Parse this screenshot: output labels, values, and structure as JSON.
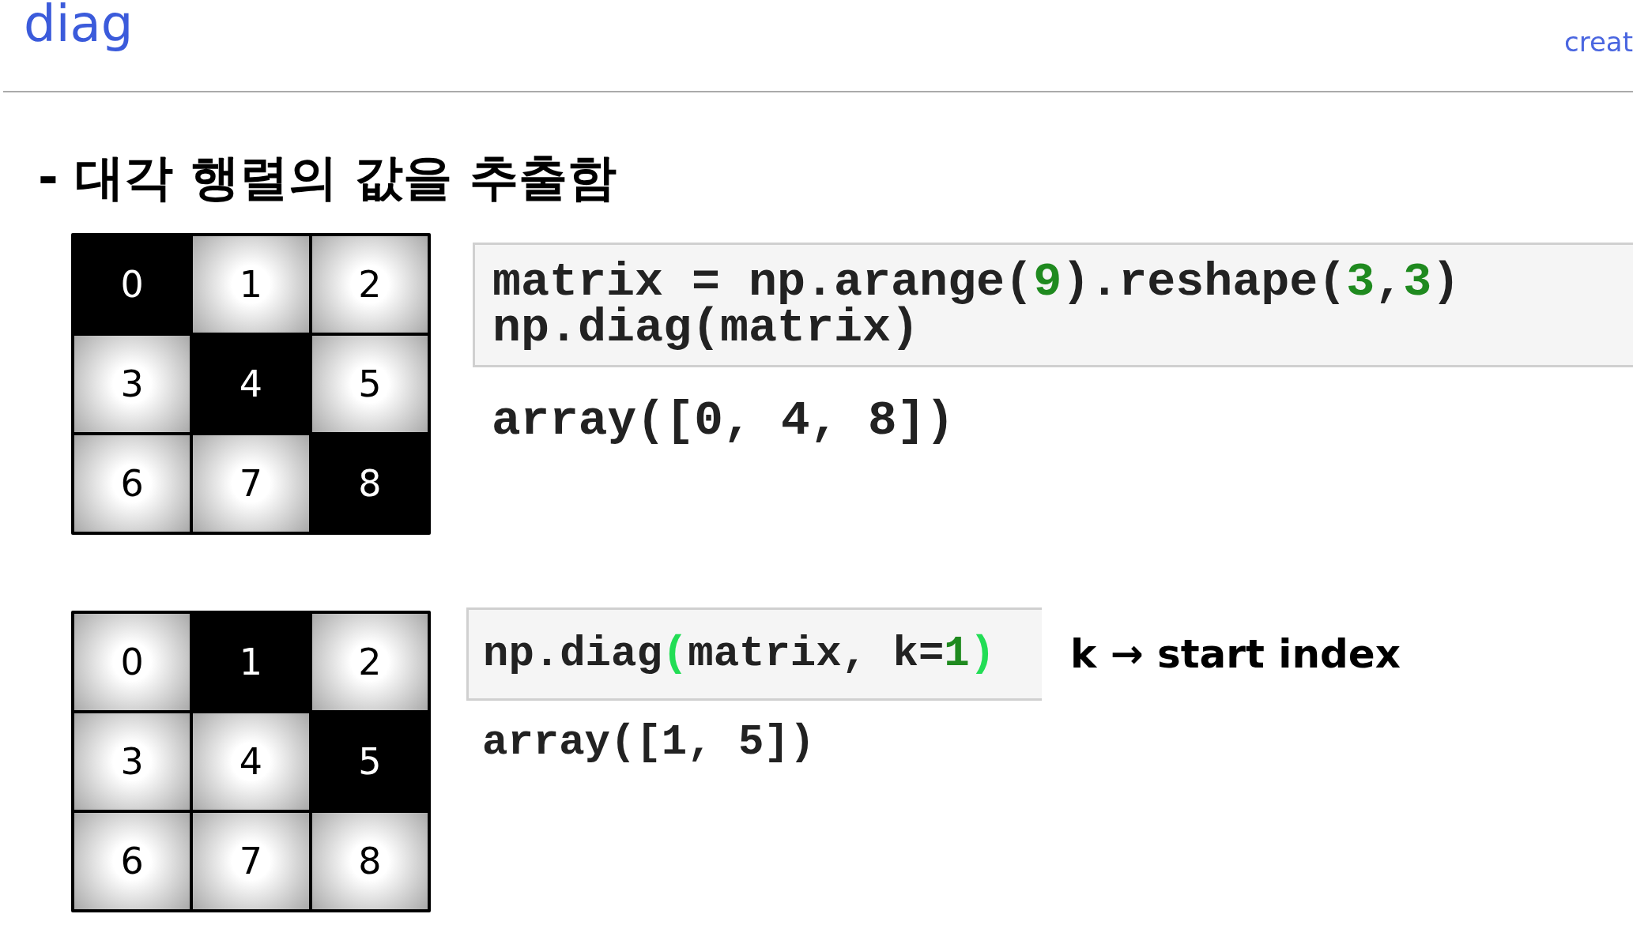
{
  "header": {
    "title": "diag",
    "link": "creat"
  },
  "heading": "- 대각 행렬의 값을 추출함",
  "examples": [
    {
      "grid": [
        {
          "label": "0",
          "highlighted": true
        },
        {
          "label": "1",
          "highlighted": false
        },
        {
          "label": "2",
          "highlighted": false
        },
        {
          "label": "3",
          "highlighted": false
        },
        {
          "label": "4",
          "highlighted": true
        },
        {
          "label": "5",
          "highlighted": false
        },
        {
          "label": "6",
          "highlighted": false
        },
        {
          "label": "7",
          "highlighted": false
        },
        {
          "label": "8",
          "highlighted": true
        }
      ],
      "code_lines": [
        [
          {
            "text": "matrix = np.arange(",
            "kind": "plain"
          },
          {
            "text": "9",
            "kind": "number"
          },
          {
            "text": ").reshape(",
            "kind": "plain"
          },
          {
            "text": "3",
            "kind": "number"
          },
          {
            "text": ",",
            "kind": "plain"
          },
          {
            "text": "3",
            "kind": "number"
          },
          {
            "text": ")",
            "kind": "plain"
          }
        ],
        [
          {
            "text": "np.diag(matrix)",
            "kind": "plain"
          }
        ]
      ],
      "output": "array([0, 4, 8])"
    },
    {
      "grid": [
        {
          "label": "0",
          "highlighted": false
        },
        {
          "label": "1",
          "highlighted": true
        },
        {
          "label": "2",
          "highlighted": false
        },
        {
          "label": "3",
          "highlighted": false
        },
        {
          "label": "4",
          "highlighted": false
        },
        {
          "label": "5",
          "highlighted": true
        },
        {
          "label": "6",
          "highlighted": false
        },
        {
          "label": "7",
          "highlighted": false
        },
        {
          "label": "8",
          "highlighted": false
        }
      ],
      "code_lines": [
        [
          {
            "text": "np.diag",
            "kind": "plain"
          },
          {
            "text": "(",
            "kind": "match"
          },
          {
            "text": "matrix, k=",
            "kind": "plain"
          },
          {
            "text": "1",
            "kind": "number"
          },
          {
            "text": ")",
            "kind": "match"
          }
        ]
      ],
      "note": "k → start index",
      "output": "array([1, 5])"
    }
  ]
}
